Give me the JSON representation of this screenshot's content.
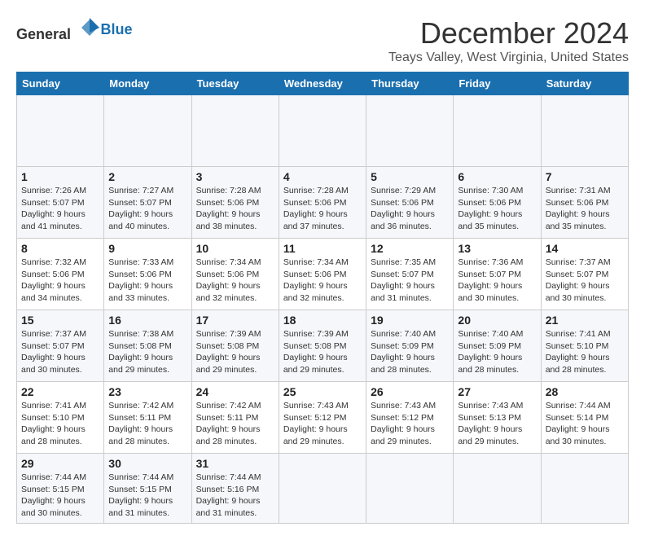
{
  "header": {
    "logo_general": "General",
    "logo_blue": "Blue",
    "month_title": "December 2024",
    "location": "Teays Valley, West Virginia, United States"
  },
  "calendar": {
    "days_of_week": [
      "Sunday",
      "Monday",
      "Tuesday",
      "Wednesday",
      "Thursday",
      "Friday",
      "Saturday"
    ],
    "weeks": [
      [
        {
          "day": "",
          "empty": true
        },
        {
          "day": "",
          "empty": true
        },
        {
          "day": "",
          "empty": true
        },
        {
          "day": "",
          "empty": true
        },
        {
          "day": "",
          "empty": true
        },
        {
          "day": "",
          "empty": true
        },
        {
          "day": "",
          "empty": true
        }
      ],
      [
        {
          "day": "1",
          "sunrise": "7:26 AM",
          "sunset": "5:07 PM",
          "daylight": "9 hours and 41 minutes."
        },
        {
          "day": "2",
          "sunrise": "7:27 AM",
          "sunset": "5:07 PM",
          "daylight": "9 hours and 40 minutes."
        },
        {
          "day": "3",
          "sunrise": "7:28 AM",
          "sunset": "5:06 PM",
          "daylight": "9 hours and 38 minutes."
        },
        {
          "day": "4",
          "sunrise": "7:28 AM",
          "sunset": "5:06 PM",
          "daylight": "9 hours and 37 minutes."
        },
        {
          "day": "5",
          "sunrise": "7:29 AM",
          "sunset": "5:06 PM",
          "daylight": "9 hours and 36 minutes."
        },
        {
          "day": "6",
          "sunrise": "7:30 AM",
          "sunset": "5:06 PM",
          "daylight": "9 hours and 35 minutes."
        },
        {
          "day": "7",
          "sunrise": "7:31 AM",
          "sunset": "5:06 PM",
          "daylight": "9 hours and 35 minutes."
        }
      ],
      [
        {
          "day": "8",
          "sunrise": "7:32 AM",
          "sunset": "5:06 PM",
          "daylight": "9 hours and 34 minutes."
        },
        {
          "day": "9",
          "sunrise": "7:33 AM",
          "sunset": "5:06 PM",
          "daylight": "9 hours and 33 minutes."
        },
        {
          "day": "10",
          "sunrise": "7:34 AM",
          "sunset": "5:06 PM",
          "daylight": "9 hours and 32 minutes."
        },
        {
          "day": "11",
          "sunrise": "7:34 AM",
          "sunset": "5:06 PM",
          "daylight": "9 hours and 32 minutes."
        },
        {
          "day": "12",
          "sunrise": "7:35 AM",
          "sunset": "5:07 PM",
          "daylight": "9 hours and 31 minutes."
        },
        {
          "day": "13",
          "sunrise": "7:36 AM",
          "sunset": "5:07 PM",
          "daylight": "9 hours and 30 minutes."
        },
        {
          "day": "14",
          "sunrise": "7:37 AM",
          "sunset": "5:07 PM",
          "daylight": "9 hours and 30 minutes."
        }
      ],
      [
        {
          "day": "15",
          "sunrise": "7:37 AM",
          "sunset": "5:07 PM",
          "daylight": "9 hours and 30 minutes."
        },
        {
          "day": "16",
          "sunrise": "7:38 AM",
          "sunset": "5:08 PM",
          "daylight": "9 hours and 29 minutes."
        },
        {
          "day": "17",
          "sunrise": "7:39 AM",
          "sunset": "5:08 PM",
          "daylight": "9 hours and 29 minutes."
        },
        {
          "day": "18",
          "sunrise": "7:39 AM",
          "sunset": "5:08 PM",
          "daylight": "9 hours and 29 minutes."
        },
        {
          "day": "19",
          "sunrise": "7:40 AM",
          "sunset": "5:09 PM",
          "daylight": "9 hours and 28 minutes."
        },
        {
          "day": "20",
          "sunrise": "7:40 AM",
          "sunset": "5:09 PM",
          "daylight": "9 hours and 28 minutes."
        },
        {
          "day": "21",
          "sunrise": "7:41 AM",
          "sunset": "5:10 PM",
          "daylight": "9 hours and 28 minutes."
        }
      ],
      [
        {
          "day": "22",
          "sunrise": "7:41 AM",
          "sunset": "5:10 PM",
          "daylight": "9 hours and 28 minutes."
        },
        {
          "day": "23",
          "sunrise": "7:42 AM",
          "sunset": "5:11 PM",
          "daylight": "9 hours and 28 minutes."
        },
        {
          "day": "24",
          "sunrise": "7:42 AM",
          "sunset": "5:11 PM",
          "daylight": "9 hours and 28 minutes."
        },
        {
          "day": "25",
          "sunrise": "7:43 AM",
          "sunset": "5:12 PM",
          "daylight": "9 hours and 29 minutes."
        },
        {
          "day": "26",
          "sunrise": "7:43 AM",
          "sunset": "5:12 PM",
          "daylight": "9 hours and 29 minutes."
        },
        {
          "day": "27",
          "sunrise": "7:43 AM",
          "sunset": "5:13 PM",
          "daylight": "9 hours and 29 minutes."
        },
        {
          "day": "28",
          "sunrise": "7:44 AM",
          "sunset": "5:14 PM",
          "daylight": "9 hours and 30 minutes."
        }
      ],
      [
        {
          "day": "29",
          "sunrise": "7:44 AM",
          "sunset": "5:15 PM",
          "daylight": "9 hours and 30 minutes."
        },
        {
          "day": "30",
          "sunrise": "7:44 AM",
          "sunset": "5:15 PM",
          "daylight": "9 hours and 31 minutes."
        },
        {
          "day": "31",
          "sunrise": "7:44 AM",
          "sunset": "5:16 PM",
          "daylight": "9 hours and 31 minutes."
        },
        {
          "day": "",
          "empty": true
        },
        {
          "day": "",
          "empty": true
        },
        {
          "day": "",
          "empty": true
        },
        {
          "day": "",
          "empty": true
        }
      ]
    ]
  }
}
